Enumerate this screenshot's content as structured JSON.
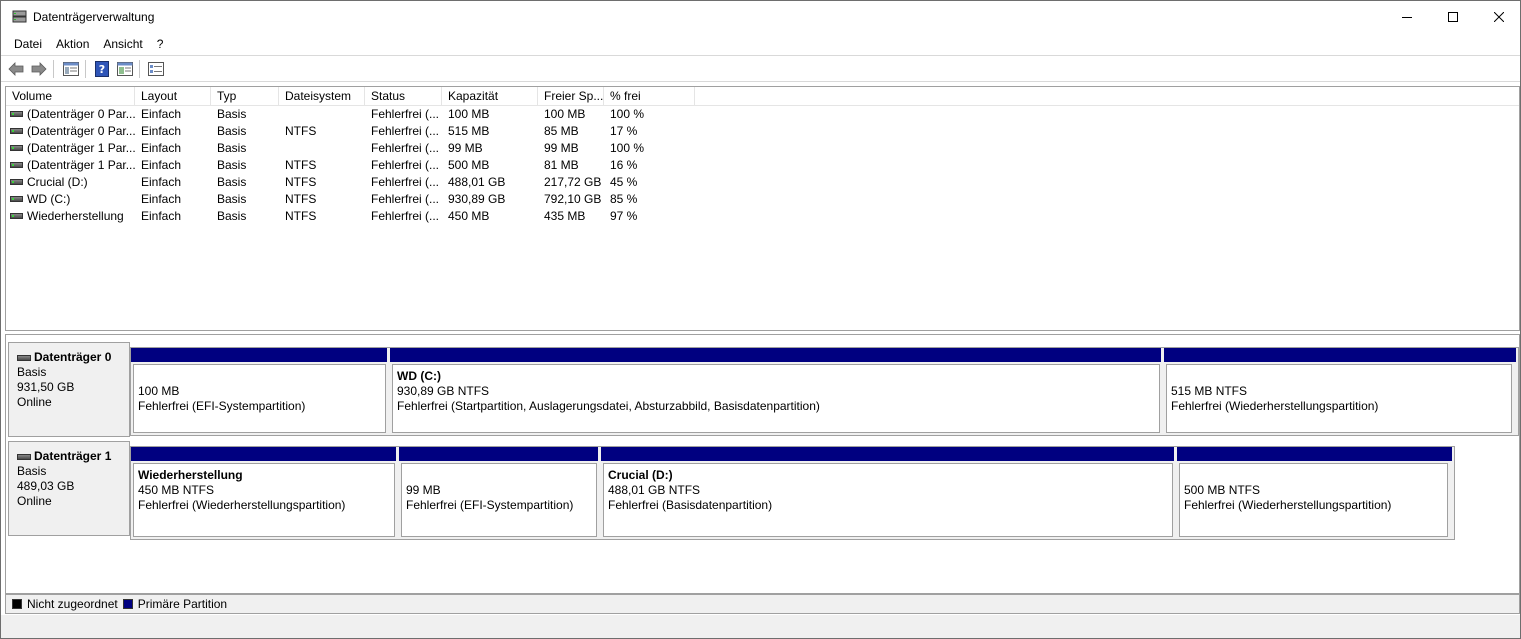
{
  "window": {
    "title": "Datenträgerverwaltung"
  },
  "menu": [
    "Datei",
    "Aktion",
    "Ansicht",
    "?"
  ],
  "toolbar": {
    "icons": [
      "back-icon",
      "forward-icon",
      "console-icon",
      "help-icon",
      "properties-icon",
      "settings-icon"
    ]
  },
  "list": {
    "columns": [
      "Volume",
      "Layout",
      "Typ",
      "Dateisystem",
      "Status",
      "Kapazität",
      "Freier Sp...",
      "% frei"
    ],
    "rows": [
      [
        "(Datenträger 0 Par...",
        "Einfach",
        "Basis",
        "",
        "Fehlerfrei (...",
        "100 MB",
        "100 MB",
        "100 %"
      ],
      [
        "(Datenträger 0 Par...",
        "Einfach",
        "Basis",
        "NTFS",
        "Fehlerfrei (...",
        "515 MB",
        "85 MB",
        "17 %"
      ],
      [
        "(Datenträger 1 Par...",
        "Einfach",
        "Basis",
        "",
        "Fehlerfrei (...",
        "99 MB",
        "99 MB",
        "100 %"
      ],
      [
        "(Datenträger 1 Par...",
        "Einfach",
        "Basis",
        "NTFS",
        "Fehlerfrei (...",
        "500 MB",
        "81 MB",
        "16 %"
      ],
      [
        "Crucial (D:)",
        "Einfach",
        "Basis",
        "NTFS",
        "Fehlerfrei (...",
        "488,01 GB",
        "217,72 GB",
        "45 %"
      ],
      [
        "WD (C:)",
        "Einfach",
        "Basis",
        "NTFS",
        "Fehlerfrei (...",
        "930,89 GB",
        "792,10 GB",
        "85 %"
      ],
      [
        "Wiederherstellung",
        "Einfach",
        "Basis",
        "NTFS",
        "Fehlerfrei (...",
        "450 MB",
        "435 MB",
        "97 %"
      ]
    ]
  },
  "disks": [
    {
      "name": "Datenträger 0",
      "type": "Basis",
      "size": "931,50 GB",
      "state": "Online",
      "partitions": [
        {
          "title": "",
          "size": "100 MB",
          "status": "Fehlerfrei (EFI-Systempartition)"
        },
        {
          "title": "WD  (C:)",
          "size": "930,89 GB NTFS",
          "status": "Fehlerfrei (Startpartition, Auslagerungsdatei, Absturzabbild, Basisdatenpartition)"
        },
        {
          "title": "",
          "size": "515 MB NTFS",
          "status": "Fehlerfrei (Wiederherstellungspartition)"
        }
      ]
    },
    {
      "name": "Datenträger 1",
      "type": "Basis",
      "size": "489,03 GB",
      "state": "Online",
      "partitions": [
        {
          "title": "Wiederherstellung",
          "size": "450 MB NTFS",
          "status": "Fehlerfrei (Wiederherstellungspartition)"
        },
        {
          "title": "",
          "size": "99 MB",
          "status": "Fehlerfrei (EFI-Systempartition)"
        },
        {
          "title": "Crucial  (D:)",
          "size": "488,01 GB NTFS",
          "status": "Fehlerfrei (Basisdatenpartition)"
        },
        {
          "title": "",
          "size": "500 MB NTFS",
          "status": "Fehlerfrei (Wiederherstellungspartition)"
        }
      ]
    }
  ],
  "legend": [
    {
      "label": "Nicht zugeordnet",
      "color": "#000000"
    },
    {
      "label": "Primäre Partition",
      "color": "#000080"
    }
  ]
}
